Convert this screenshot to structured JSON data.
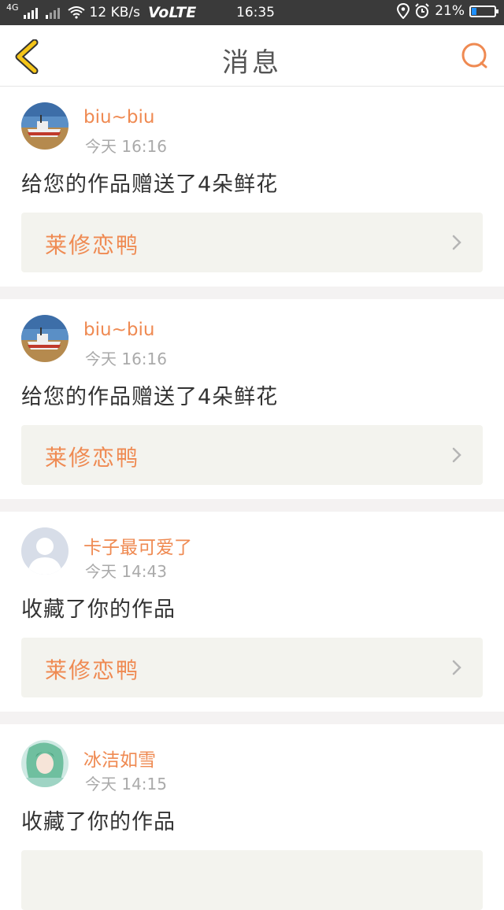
{
  "status_bar": {
    "net_type": "4G",
    "speed": "12 KB/s",
    "volte": "VoLTE",
    "time": "16:35",
    "battery": "21%",
    "battery_level": 0.21
  },
  "header": {
    "title": "消息"
  },
  "notifications": [
    {
      "username": "biu~biu",
      "time": "今天 16:16",
      "message": "给您的作品赠送了4朵鲜花",
      "work_title": "莱修恋鸭",
      "avatar": "boat-photo"
    },
    {
      "username": "biu~biu",
      "time": "今天 16:16",
      "message": "给您的作品赠送了4朵鲜花",
      "work_title": "莱修恋鸭",
      "avatar": "boat-photo"
    },
    {
      "username": "卡子最可爱了",
      "time": "今天 14:43",
      "message": "收藏了你的作品",
      "work_title": "莱修恋鸭",
      "avatar": "default-person"
    },
    {
      "username": "冰洁如雪",
      "time": "今天 14:15",
      "message": "收藏了你的作品",
      "work_title": "",
      "avatar": "anime-girl"
    }
  ],
  "colors": {
    "accent": "#ef8a52",
    "back_icon": "#f5c518",
    "status_bar_bg": "#3a3a3a",
    "link_bg": "#f3f3ee"
  }
}
